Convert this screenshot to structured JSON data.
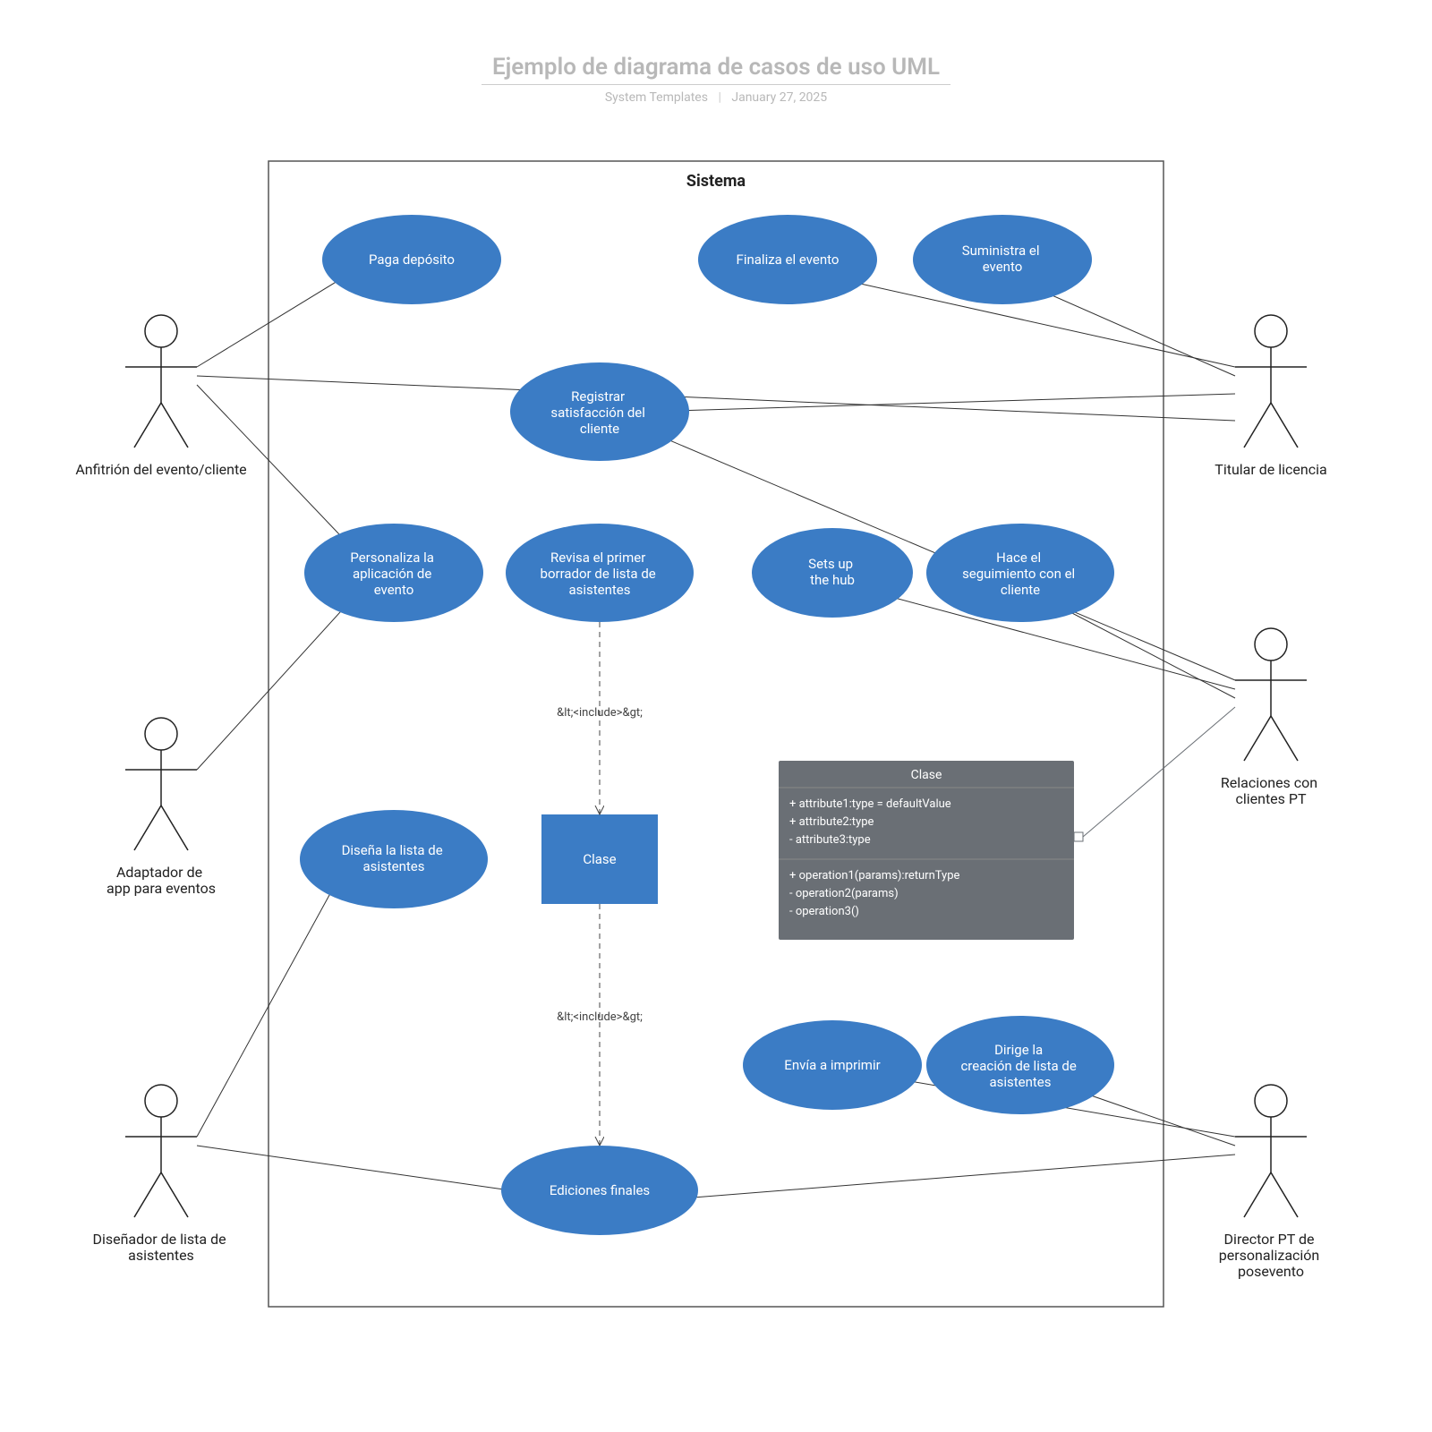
{
  "title": "Ejemplo de diagrama de casos de uso UML",
  "meta": {
    "author": "System Templates",
    "date": "January 27, 2025"
  },
  "system_label": "Sistema",
  "actors": {
    "host": "Anfitrión del evento/cliente",
    "adapter": "Adaptador de\napp para eventos",
    "designer": "Diseñador de lista de\nasistentes",
    "licensee": "Titular de licencia",
    "crm": "Relaciones con\nclientes PT",
    "director": "Director PT de\npersonalización\nposevento"
  },
  "usecases": {
    "pay": "Paga depósito",
    "finalize": "Finaliza el evento",
    "supply": "Suministra el\nevento",
    "satisfy": "Registrar\nsatisfacción del\ncliente",
    "customize": "Personaliza la\naplicación de\nevento",
    "review": "Revisa el primer\nborrador de lista de\nasistentes",
    "setup": "Sets up\nthe hub",
    "follow": "Hace el\nseguimiento con el\ncliente",
    "design": "Diseña la lista de\nasistentes",
    "class_box": "Clase",
    "print": "Envía a imprimir",
    "direct": "Dirige la\ncreación de lista de\nasistentes",
    "final": "Ediciones finales"
  },
  "edge_label": "&lt;<include>&gt;",
  "class_card": {
    "title": "Clase",
    "attrs": [
      "+ attribute1:type = defaultValue",
      "+ attribute2:type",
      "- attribute3:type"
    ],
    "ops": [
      "+ operation1(params):returnType",
      "- operation2(params)",
      "- operation3()"
    ]
  }
}
